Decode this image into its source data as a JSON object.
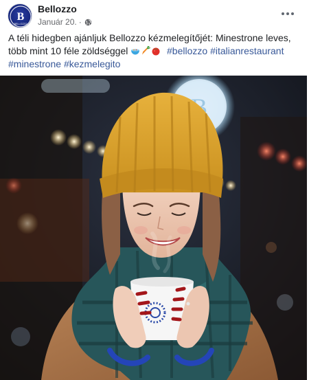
{
  "post": {
    "page_name": "Bellozzo",
    "date": "Január 20.",
    "separator": "·",
    "avatar_logo_letter": "B",
    "avatar_logo_text": "BELLOZZO",
    "icons": {
      "privacy": "globe-icon",
      "options": "more-options-icon"
    },
    "text": {
      "line1": "A téli hidegben ajánljuk Bellozzo kézmelegítőjét: Minestrone leves,",
      "line2_text": "több mint 10 féle zöldséggel ",
      "emojis": [
        "bowl-emoji",
        "carrot-emoji",
        "tomato-emoji"
      ],
      "hashtags": [
        "#bellozzo",
        "#italianrestaurant",
        "#minestrone",
        "#kezmelegito"
      ]
    },
    "photo": {
      "description_icon": "post-photo",
      "sign_letter": "B"
    }
  }
}
